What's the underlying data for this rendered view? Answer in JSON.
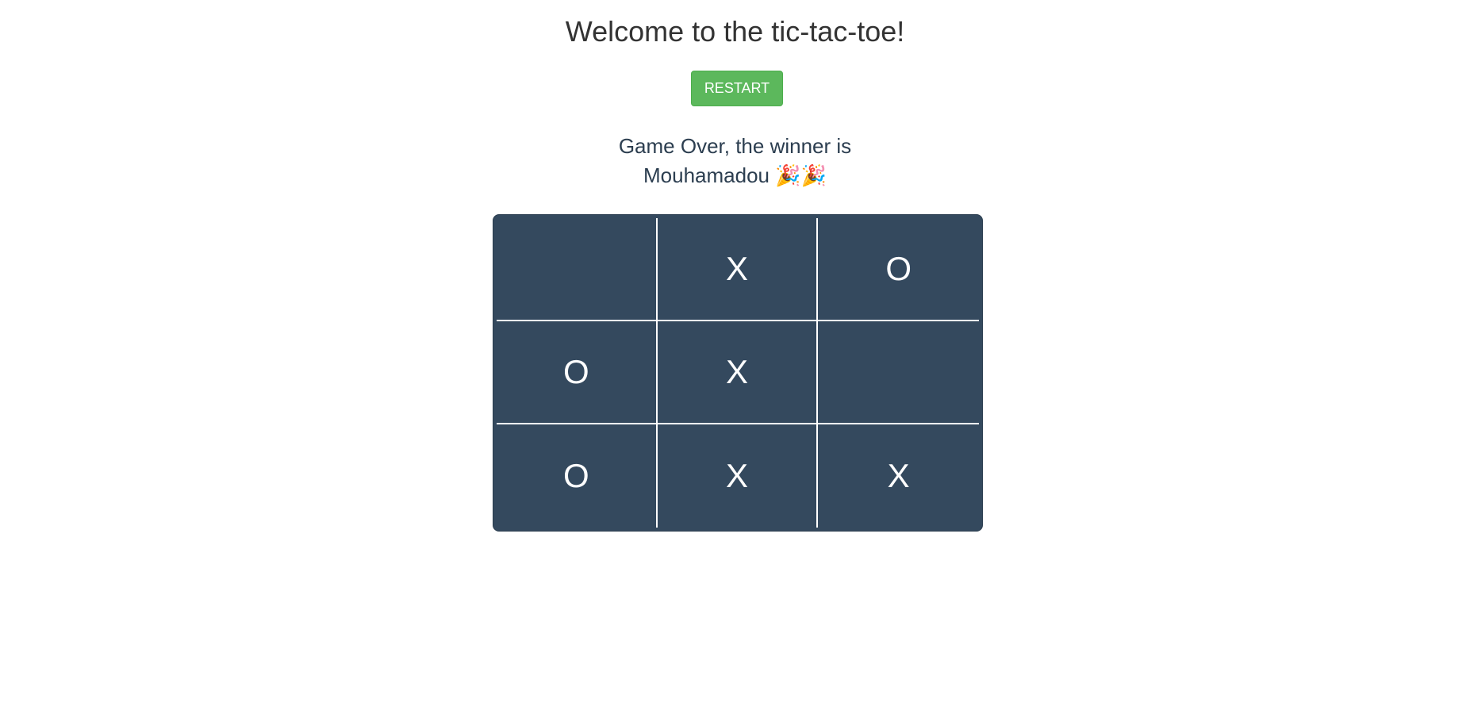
{
  "header": {
    "title": "Welcome to the tic-tac-toe!"
  },
  "controls": {
    "restart_label": "RESTART",
    "restart_color": "#5cb85c"
  },
  "status": {
    "line1": "Game Over, the winner is",
    "line2": "Mouhamadou 🎉🎉"
  },
  "board": {
    "background_color": "#34495e",
    "cells": [
      [
        "",
        "X",
        "O"
      ],
      [
        "O",
        "X",
        ""
      ],
      [
        "O",
        "X",
        "X"
      ]
    ]
  }
}
